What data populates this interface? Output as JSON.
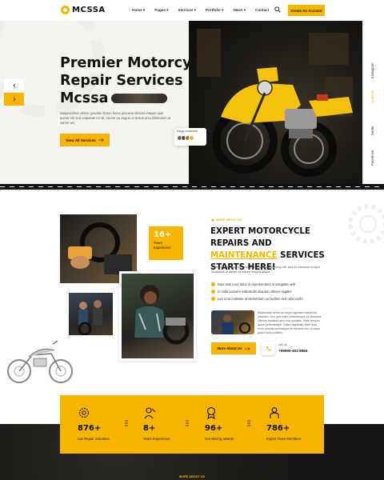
{
  "brand": {
    "name": "MCSSA",
    "accent": "#f7b500"
  },
  "nav": {
    "items": [
      "Home ▾",
      "Pages ▾",
      "Services ▾",
      "Portfolio ▾",
      "News ▾",
      "Contact"
    ],
    "cta": "Create An Account"
  },
  "hero": {
    "title_lines": [
      "Premier Motorcycle",
      "Repair Services",
      "Mcssa"
    ],
    "description": "Suspendisse ultrice gravida dictum fusce placerat ultrices integer quis auctor elit sed vulputate mi sit. Auctor eu augue ut lectus arcu bibendum at varius vel.",
    "button": "View All Services",
    "happy_label": "Happy Customers",
    "social": [
      "Facebook",
      "twitter",
      "Linkedin",
      "Instagram"
    ]
  },
  "about": {
    "eyebrow": "MORE ABOUT US",
    "title_part1": "EXPERT MOTORCYCLE REPAIRS AND ",
    "title_highlight": "MAINTENANCE",
    "title_part2": " SERVICES STARTS HERE!",
    "description": "Lorem ipsum dolor sit amet, consectetur adipiscing elit, sed do eiusmod tempor incididunt ut labore et dolore magna aliqua.",
    "checks": [
      "Duis aute irure dolor in reprehenderit in voluptate velit",
      "In nulla possere sollicitudin aliquam ultrices sagittis",
      "Leo urna molestie at elementum eu facilisis sed odio morbi"
    ],
    "small_text": "Malesuada fames ac turpis egestas maecenas pharetra. Non quis enim pellentesque eu tincidunt. Ultrices tincidunt arcu non sodales. Vitae tempus quam pellentesque. Etiam dignissim diam quis enim lobortis scelerisque fermentum dui. Ut diam quam nulla porttitor.",
    "more_button": "More About Us",
    "call_label": "call us",
    "phone": "+99990-453-8884",
    "experience_number": "16+",
    "experience_label": "Years Experience"
  },
  "stats": [
    {
      "number": "876+",
      "label": "Car Repair Solutions",
      "icon": "gear-wrench-icon"
    },
    {
      "number": "8+",
      "label": "Years Experience",
      "icon": "mechanic-icon"
    },
    {
      "number": "96+",
      "label": "Get Wining awards",
      "icon": "award-icon"
    },
    {
      "number": "786+",
      "label": "Expert Team Members",
      "icon": "team-icon"
    }
  ],
  "footer_eyebrow": "MORE ABOUT US"
}
